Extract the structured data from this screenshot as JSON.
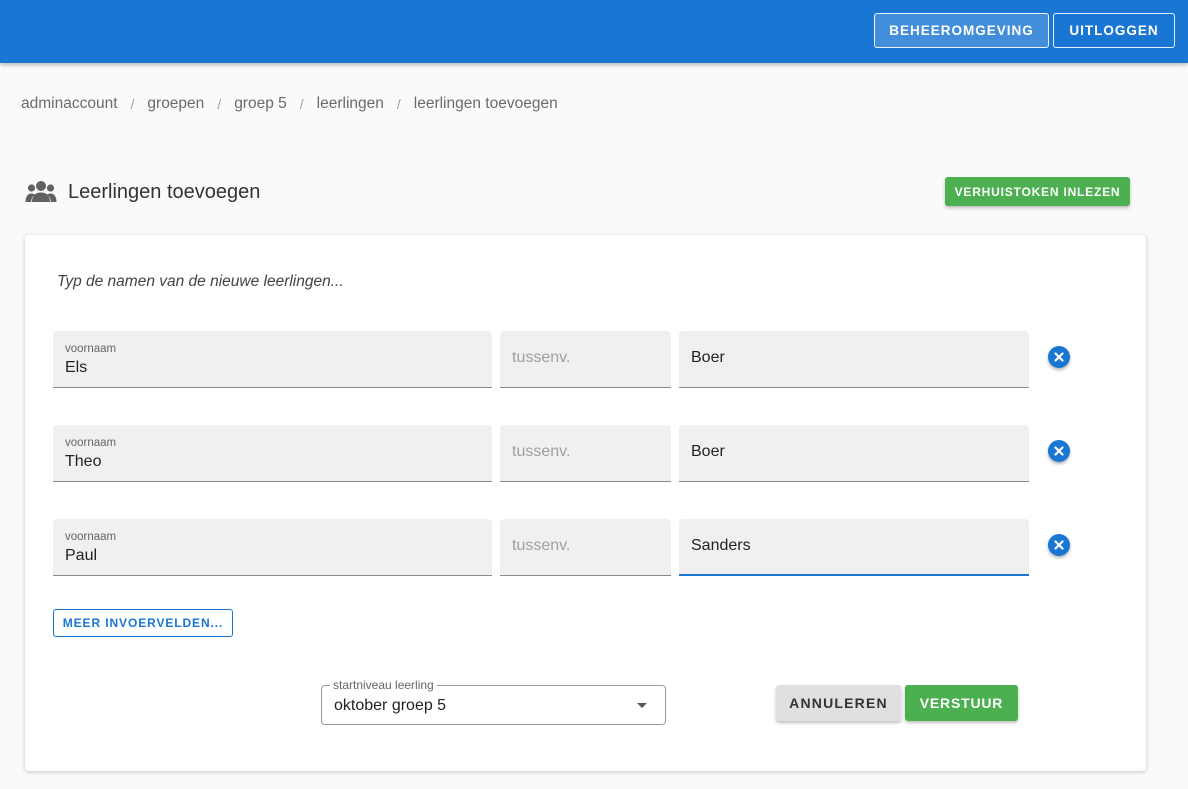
{
  "header": {
    "admin_label": "BEHEEROMGEVING",
    "logout_label": "UITLOGGEN",
    "color": "#1976d2"
  },
  "breadcrumb": [
    "adminaccount",
    "groepen",
    "groep 5",
    "leerlingen",
    "leerlingen toevoegen"
  ],
  "breadcrumb_separator": "/",
  "page": {
    "icon": "people-icon",
    "title": "Leerlingen toevoegen",
    "read_token_label": "VERHUISTOKEN INLEZEN"
  },
  "form": {
    "hint": "Typ de namen van de nieuwe leerlingen...",
    "first_name_label": "voornaam",
    "infix_placeholder": "tussenv.",
    "rows": [
      {
        "first_name": "Els",
        "infix": "",
        "last_name": "Boer"
      },
      {
        "first_name": "Theo",
        "infix": "",
        "last_name": "Boer"
      },
      {
        "first_name": "Paul",
        "infix": "",
        "last_name": "Sanders"
      }
    ],
    "more_fields_label": "MEER INVOERVELDEN...",
    "level_label": "startniveau leerling",
    "level_value": "oktober groep 5",
    "cancel_label": "ANNULEREN",
    "submit_label": "VERSTUUR"
  },
  "colors": {
    "primary": "#1976d2",
    "success": "#4caf50"
  }
}
